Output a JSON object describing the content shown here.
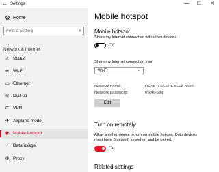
{
  "window": {
    "title": "Settings",
    "back_glyph": "←",
    "minimize_glyph": "—",
    "maximize_glyph": "☐",
    "close_glyph": "✕"
  },
  "sidebar": {
    "home_label": "Home",
    "home_icon": "⚙",
    "search_placeholder": "Find a setting",
    "search_icon": "⌕",
    "section_label": "Network & Internet",
    "items": [
      {
        "label": "Status",
        "icon": "⌂"
      },
      {
        "label": "Wi-Fi",
        "icon": "≋"
      },
      {
        "label": "Ethernet",
        "icon": "▭"
      },
      {
        "label": "Dial-up",
        "icon": "☏"
      },
      {
        "label": "VPN",
        "icon": "⊂"
      },
      {
        "label": "Airplane mode",
        "icon": "✈"
      },
      {
        "label": "Mobile hotspot",
        "icon": "◉",
        "active": true
      },
      {
        "label": "Data usage",
        "icon": "◔"
      },
      {
        "label": "Proxy",
        "icon": "⊕"
      }
    ]
  },
  "main": {
    "page_title": "Mobile hotspot",
    "hotspot": {
      "heading": "Mobile hotspot",
      "description": "Share my Internet connection with other devices",
      "toggle_state": "Off"
    },
    "share_from": {
      "label": "Share my Internet connection from",
      "selected": "Wi-Fi"
    },
    "network": {
      "name_label": "Network name:",
      "name_value": "DESKTOP-EDEVEPA 8599",
      "password_label": "Network password:",
      "password_value": "6%4!F59g",
      "edit_label": "Edit"
    },
    "remote": {
      "heading": "Turn on remotely",
      "description_line1": "Allow another device to turn on mobile hotspot. Both devices",
      "description_line2": "must have Bluetooth turned on and be paired.",
      "toggle_state": "On"
    },
    "related_heading": "Related settings"
  },
  "colors": {
    "accent": "#c8102e",
    "toggle_on": "#e81123",
    "sidebar_bg": "#f2f2f2"
  }
}
